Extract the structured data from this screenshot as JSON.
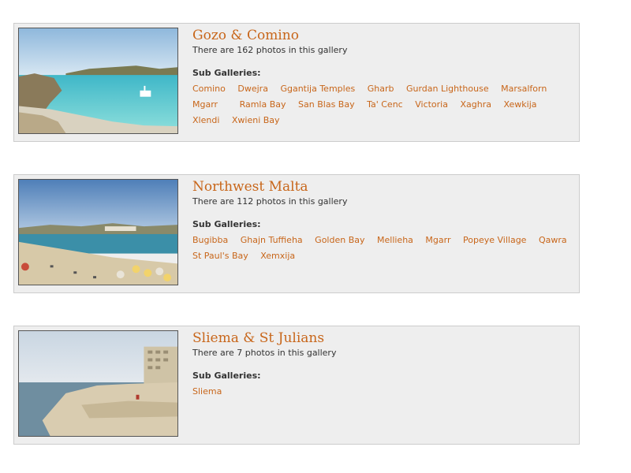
{
  "colors": {
    "accent": "#c8661a",
    "panel_bg": "#eeeeee",
    "panel_border": "#cccccc",
    "text": "#333333"
  },
  "galleries": [
    {
      "title": "Gozo & Comino",
      "count_text": "There are 162 photos in this gallery",
      "sub_heading": "Sub Galleries:",
      "sub_galleries": [
        "Comino",
        "Dwejra",
        "Ggantija Temples",
        "Gharb",
        "Gurdan Lighthouse",
        "Marsalforn",
        "Mgarr",
        "Ramla Bay",
        "San Blas Bay",
        "Ta' Cenc",
        "Victoria",
        "Xaghra",
        "Xewkija",
        "Xlendi",
        "Xwieni Bay"
      ]
    },
    {
      "title": "Northwest Malta",
      "count_text": "There are 112 photos in this gallery",
      "sub_heading": "Sub Galleries:",
      "sub_galleries": [
        "Bugibba",
        "Ghajn Tuffieha",
        "Golden Bay",
        "Mellieha",
        "Mgarr",
        "Popeye Village",
        "Qawra",
        "St Paul's Bay",
        "Xemxija"
      ]
    },
    {
      "title": "Sliema & St Julians",
      "count_text": "There are 7 photos in this gallery",
      "sub_heading": "Sub Galleries:",
      "sub_galleries": [
        "Sliema"
      ]
    }
  ]
}
